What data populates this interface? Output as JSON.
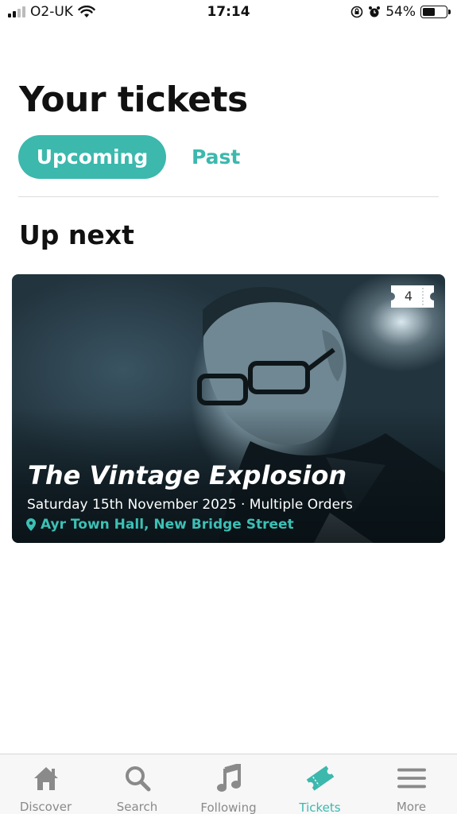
{
  "status_bar": {
    "carrier": "O2-UK",
    "time": "17:14",
    "battery": "54%",
    "battery_level": 0.54
  },
  "page_title": "Your tickets",
  "tabs": [
    {
      "label": "Upcoming",
      "active": true
    },
    {
      "label": "Past",
      "active": false
    }
  ],
  "section_heading": "Up next",
  "event": {
    "title": "The Vintage Explosion",
    "meta": "Saturday 15th November 2025 · Multiple Orders",
    "venue": "Ayr Town Hall, New Bridge Street",
    "ticket_count": "4"
  },
  "bottom_nav": [
    {
      "label": "Discover",
      "icon": "home-icon",
      "active": false
    },
    {
      "label": "Search",
      "icon": "search-icon",
      "active": false
    },
    {
      "label": "Following",
      "icon": "music-note-icon",
      "active": false
    },
    {
      "label": "Tickets",
      "icon": "ticket-icon",
      "active": true
    },
    {
      "label": "More",
      "icon": "menu-icon",
      "active": false
    }
  ],
  "colors": {
    "accent": "#3cb8ad",
    "nav_inactive": "#8a8a8a"
  }
}
